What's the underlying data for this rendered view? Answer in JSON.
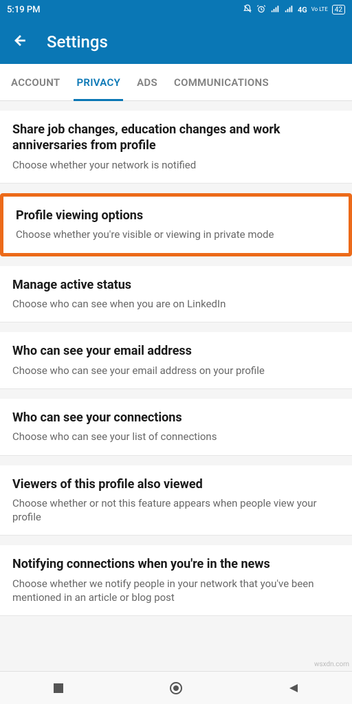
{
  "status": {
    "time": "5:19 PM",
    "network": "4G",
    "volte": "Vo LTE",
    "battery": "42"
  },
  "appbar": {
    "title": "Settings"
  },
  "tabs": [
    {
      "label": "ACCOUNT",
      "active": false
    },
    {
      "label": "PRIVACY",
      "active": true
    },
    {
      "label": "ADS",
      "active": false
    },
    {
      "label": "COMMUNICATIONS",
      "active": false
    }
  ],
  "sections": [
    {
      "title": "Share job changes, education changes and work anniversaries from profile",
      "subtitle": "Choose whether your network is notified",
      "highlighted": false
    },
    {
      "title": "Profile viewing options",
      "subtitle": "Choose whether you're visible or viewing in private mode",
      "highlighted": true
    },
    {
      "title": "Manage active status",
      "subtitle": "Choose who can see when you are on LinkedIn",
      "highlighted": false
    },
    {
      "title": "Who can see your email address",
      "subtitle": "Choose who can see your email address on your profile",
      "highlighted": false
    },
    {
      "title": "Who can see your connections",
      "subtitle": "Choose who can see your list of connections",
      "highlighted": false
    },
    {
      "title": "Viewers of this profile also viewed",
      "subtitle": "Choose whether or not this feature appears when people view your profile",
      "highlighted": false
    },
    {
      "title": "Notifying connections when you're in the news",
      "subtitle": "Choose whether we notify people in your network that you've been mentioned in an article or blog post",
      "highlighted": false
    }
  ],
  "watermark": "wsxdn.com"
}
